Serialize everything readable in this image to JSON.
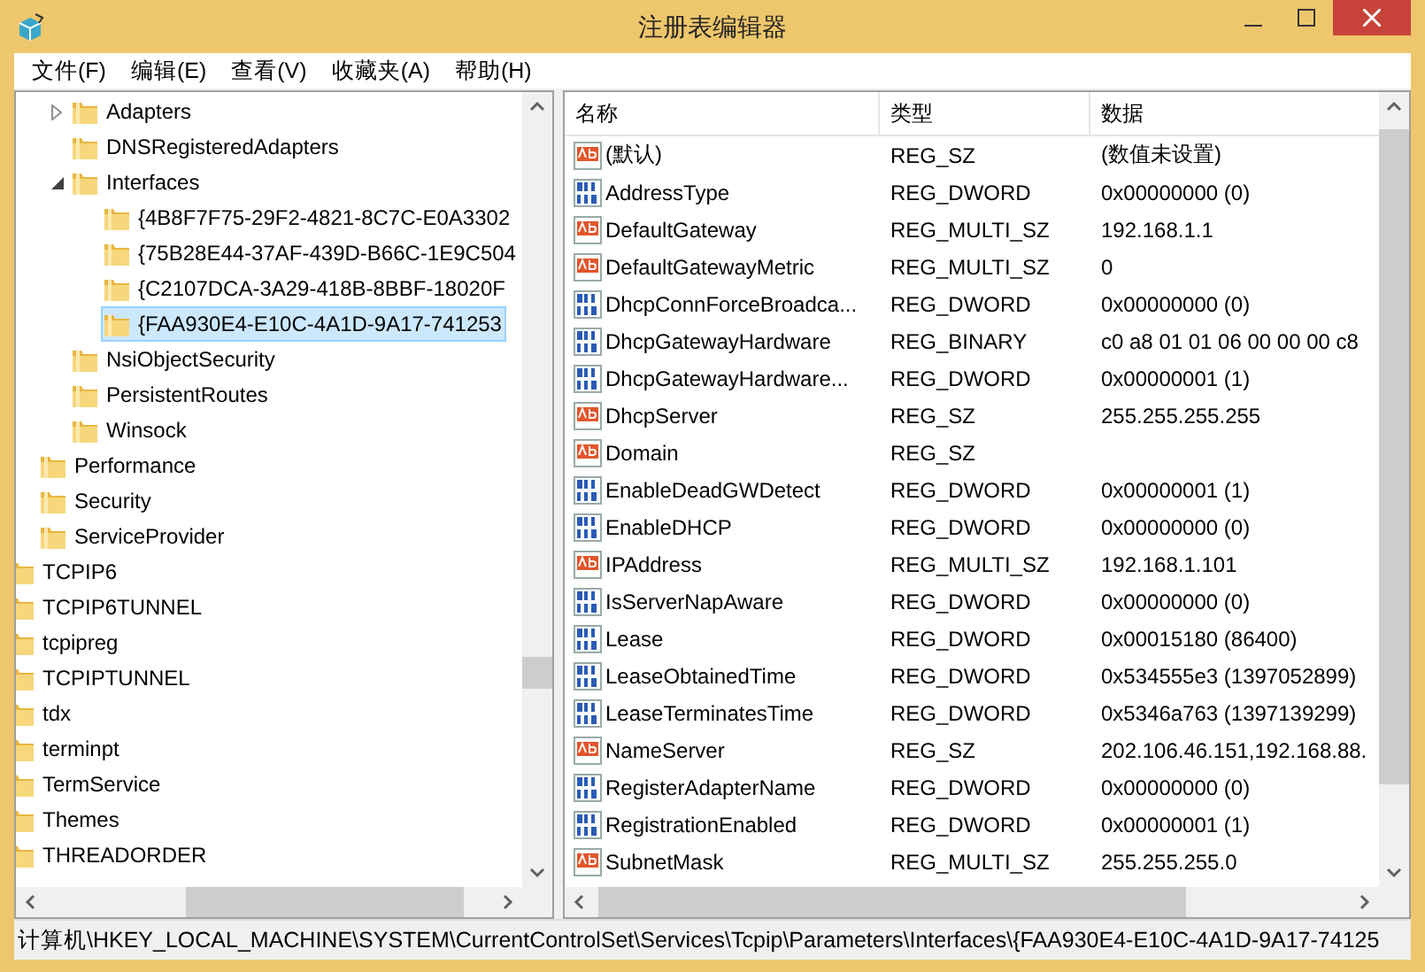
{
  "window": {
    "title": "注册表编辑器"
  },
  "menu": [
    "文件(F)",
    "编辑(E)",
    "查看(V)",
    "收藏夹(A)",
    "帮助(H)"
  ],
  "tree": {
    "items": [
      {
        "children": [
          {
            "children": [
              {
                "label": "Adapters",
                "expanded": false,
                "selected": false
              },
              {
                "label": "DNSRegisteredAdapters",
                "selected": false
              },
              {
                "label": "Interfaces",
                "expanded": true,
                "selected": false,
                "children": [
                  {
                    "label": "{4B8F7F75-29F2-4821-8C7C-E0A3302",
                    "selected": false
                  },
                  {
                    "label": "{75B28E44-37AF-439D-B66C-1E9C504",
                    "selected": false
                  },
                  {
                    "label": "{C2107DCA-3A29-418B-8BBF-18020F",
                    "selected": false
                  },
                  {
                    "label": "{FAA930E4-E10C-4A1D-9A17-741253",
                    "selected": true
                  }
                ]
              },
              {
                "label": "NsiObjectSecurity",
                "selected": false
              },
              {
                "label": "PersistentRoutes",
                "selected": false
              },
              {
                "label": "Winsock",
                "selected": false
              }
            ]
          },
          {
            "label": "Performance",
            "selected": false
          },
          {
            "label": "Security",
            "selected": false
          },
          {
            "label": "ServiceProvider",
            "selected": false
          }
        ]
      },
      {
        "label": "TCPIP6",
        "selected": false
      },
      {
        "label": "TCPIP6TUNNEL",
        "selected": false
      },
      {
        "label": "tcpipreg",
        "selected": false
      },
      {
        "label": "TCPIPTUNNEL",
        "selected": false
      },
      {
        "label": "tdx",
        "selected": false
      },
      {
        "label": "terminpt",
        "selected": false
      },
      {
        "label": "TermService",
        "selected": false
      },
      {
        "label": "Themes",
        "selected": false
      },
      {
        "label": "THREADORDER",
        "selected": false
      }
    ]
  },
  "list": {
    "columns": [
      "名称",
      "类型",
      "数据"
    ],
    "rows": [
      {
        "kind": "string",
        "name": "(默认)",
        "type": "REG_SZ",
        "data": "(数值未设置)"
      },
      {
        "kind": "binary",
        "name": "AddressType",
        "type": "REG_DWORD",
        "data": "0x00000000 (0)"
      },
      {
        "kind": "string",
        "name": "DefaultGateway",
        "type": "REG_MULTI_SZ",
        "data": "192.168.1.1"
      },
      {
        "kind": "string",
        "name": "DefaultGatewayMetric",
        "type": "REG_MULTI_SZ",
        "data": "0"
      },
      {
        "kind": "binary",
        "name": "DhcpConnForceBroadca...",
        "type": "REG_DWORD",
        "data": "0x00000000 (0)"
      },
      {
        "kind": "binary",
        "name": "DhcpGatewayHardware",
        "type": "REG_BINARY",
        "data": "c0 a8 01 01 06 00 00 00 c8"
      },
      {
        "kind": "binary",
        "name": "DhcpGatewayHardware...",
        "type": "REG_DWORD",
        "data": "0x00000001 (1)"
      },
      {
        "kind": "string",
        "name": "DhcpServer",
        "type": "REG_SZ",
        "data": "255.255.255.255"
      },
      {
        "kind": "string",
        "name": "Domain",
        "type": "REG_SZ"
      },
      {
        "kind": "binary",
        "name": "EnableDeadGWDetect",
        "type": "REG_DWORD",
        "data": "0x00000001 (1)"
      },
      {
        "kind": "binary",
        "name": "EnableDHCP",
        "type": "REG_DWORD",
        "data": "0x00000000 (0)"
      },
      {
        "kind": "string",
        "name": "IPAddress",
        "type": "REG_MULTI_SZ",
        "data": "192.168.1.101"
      },
      {
        "kind": "binary",
        "name": "IsServerNapAware",
        "type": "REG_DWORD",
        "data": "0x00000000 (0)"
      },
      {
        "kind": "binary",
        "name": "Lease",
        "type": "REG_DWORD",
        "data": "0x00015180 (86400)"
      },
      {
        "kind": "binary",
        "name": "LeaseObtainedTime",
        "type": "REG_DWORD",
        "data": "0x534555e3 (1397052899)"
      },
      {
        "kind": "binary",
        "name": "LeaseTerminatesTime",
        "type": "REG_DWORD",
        "data": "0x5346a763 (1397139299)"
      },
      {
        "kind": "string",
        "name": "NameServer",
        "type": "REG_SZ",
        "data": "202.106.46.151,192.168.88."
      },
      {
        "kind": "binary",
        "name": "RegisterAdapterName",
        "type": "REG_DWORD",
        "data": "0x00000000 (0)"
      },
      {
        "kind": "binary",
        "name": "RegistrationEnabled",
        "type": "REG_DWORD",
        "data": "0x00000001 (1)"
      },
      {
        "kind": "string",
        "name": "SubnetMask",
        "type": "REG_MULTI_SZ",
        "data": "255.255.255.0"
      }
    ]
  },
  "status_bar": "计算机\\HKEY_LOCAL_MACHINE\\SYSTEM\\CurrentControlSet\\Services\\Tcpip\\Parameters\\Interfaces\\{FAA930E4-E10C-4A1D-9A17-74125"
}
